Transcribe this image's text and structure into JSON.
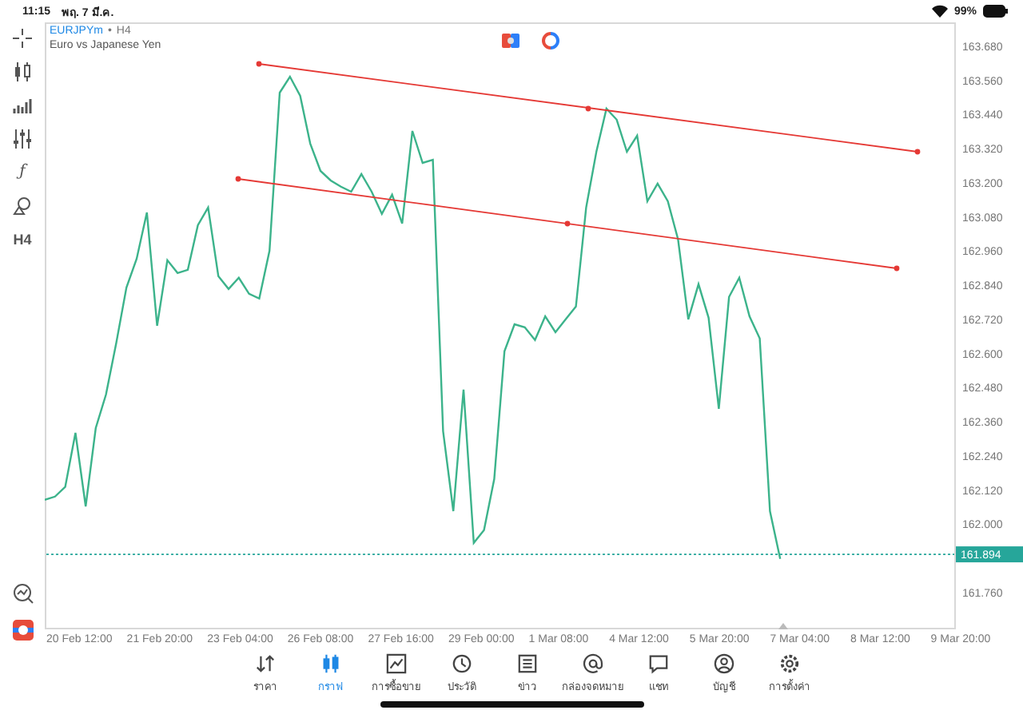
{
  "status_bar": {
    "time": "11:15",
    "date": "พฤ. 7 มี.ค.",
    "battery": "99%"
  },
  "left_toolbar": [
    {
      "kind": "crosshair"
    },
    {
      "kind": "candles"
    },
    {
      "kind": "indicators"
    },
    {
      "kind": "sliders"
    },
    {
      "kind": "text",
      "label": "ƒ"
    },
    {
      "kind": "shapes"
    },
    {
      "kind": "text",
      "label": "H4"
    }
  ],
  "left_toolbar_bottom": [
    {
      "kind": "analysis"
    },
    {
      "kind": "app"
    }
  ],
  "chart": {
    "separator": "•",
    "timeframe": "H4",
    "description": "Euro vs Japanese Yen",
    "time_axis": [
      "20 Feb 12:00",
      "21 Feb 20:00",
      "23 Feb 04:00",
      "26 Feb 08:00",
      "27 Feb 16:00",
      "29 Feb 00:00",
      "1 Mar 08:00",
      "4 Mar 12:00",
      "5 Mar 20:00",
      "7 Mar 04:00",
      "8 Mar 12:00",
      "9 Mar 20:00"
    ],
    "chart_data": {
      "type": "line",
      "ylim": [
        161.636,
        163.764
      ],
      "ref_lines": [
        {
          "axis": "y",
          "value": 161.894,
          "label": "161.894"
        }
      ],
      "series": [
        {
          "name": "EURJPYm",
          "color": "#3cb38b",
          "values": [
            162.086,
            162.097,
            162.131,
            162.321,
            162.063,
            162.338,
            162.456,
            162.636,
            162.832,
            162.933,
            163.096,
            162.698,
            162.928,
            162.883,
            162.894,
            163.051,
            163.113,
            162.872,
            162.827,
            162.866,
            162.81,
            162.793,
            162.961,
            163.517,
            163.573,
            163.506,
            163.338,
            163.242,
            163.208,
            163.186,
            163.169,
            163.231,
            163.169,
            163.091,
            163.158,
            163.057,
            163.382,
            163.27,
            163.281,
            162.327,
            162.046,
            162.473,
            161.934,
            161.979,
            162.159,
            162.608,
            162.703,
            162.692,
            162.647,
            162.731,
            162.675,
            162.72,
            162.765,
            163.113,
            163.309,
            163.461,
            163.422,
            163.309,
            163.366,
            163.135,
            163.197,
            163.135,
            163.001,
            162.72,
            162.844,
            162.726,
            162.406,
            162.799,
            162.866,
            162.731,
            162.653,
            162.046,
            161.878
          ]
        }
      ],
      "yticks": [
        {
          "value": 163.68,
          "label": "163.680"
        },
        {
          "value": 163.56,
          "label": "163.560"
        },
        {
          "value": 163.44,
          "label": "163.440"
        },
        {
          "value": 163.32,
          "label": "163.320"
        },
        {
          "value": 163.2,
          "label": "163.200"
        },
        {
          "value": 163.08,
          "label": "163.080"
        },
        {
          "value": 162.96,
          "label": "162.960"
        },
        {
          "value": 162.84,
          "label": "162.840"
        },
        {
          "value": 162.72,
          "label": "162.720"
        },
        {
          "value": 162.6,
          "label": "162.600"
        },
        {
          "value": 162.48,
          "label": "162.480"
        },
        {
          "value": 162.36,
          "label": "162.360"
        },
        {
          "value": 162.24,
          "label": "162.240"
        },
        {
          "value": 162.12,
          "label": "162.120"
        },
        {
          "value": 162.0,
          "label": "162.000"
        },
        {
          "value": 161.76,
          "label": "161.760"
        }
      ]
    }
  },
  "tabs": [
    {
      "kind": "quotes",
      "label": "ราคา",
      "selected": false
    },
    {
      "kind": "chart",
      "label": "กราฟ",
      "selected": true
    },
    {
      "kind": "trade",
      "label": "การซื้อขาย",
      "selected": false
    },
    {
      "kind": "history",
      "label": "ประวัติ",
      "selected": false
    },
    {
      "kind": "news",
      "label": "ข่าว",
      "selected": false
    },
    {
      "kind": "mail",
      "label": "กล่องจดหมาย",
      "selected": false
    },
    {
      "kind": "chat",
      "label": "แชท",
      "selected": false
    },
    {
      "kind": "account",
      "label": "บัญชี",
      "selected": false
    },
    {
      "kind": "settings",
      "label": "การตั้งค่า",
      "selected": false
    }
  ]
}
